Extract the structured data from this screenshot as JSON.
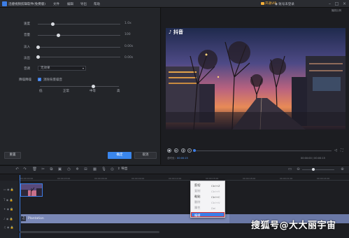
{
  "titlebar": {
    "app_title": "迅捷视频剪辑软件(免费版)",
    "menus": [
      "文件",
      "编辑",
      "导出",
      "帮助"
    ],
    "vip_label": "开通VIP",
    "user_label": "账号未登录",
    "window_buttons": [
      "minimize-icon",
      "maximize-icon",
      "close-icon"
    ]
  },
  "editor": {
    "rows": [
      {
        "label": "速度",
        "value": "1.0x",
        "level": 0.25
      },
      {
        "label": "音量",
        "value": "100",
        "level": 0.27
      },
      {
        "label": "淡入",
        "value": "0.00s",
        "level": 0.0
      },
      {
        "label": "淡出",
        "value": "0.00s",
        "level": 0.0
      }
    ],
    "rate_label": "音调",
    "rate_value": "无效果",
    "denoise_label": "降噪降噪",
    "denoise_option": "消除背景噪音",
    "denoise_checked": true,
    "levels": [
      "低",
      "正常",
      "中等",
      "高"
    ],
    "level_selected": "中等",
    "reset_label": "重置",
    "ok_label": "确定",
    "cancel_label": "取消"
  },
  "preview": {
    "mode_label": "播放比例",
    "watermark": "♪ 抖音",
    "time_current": "00:00:00",
    "time_total": "00:00:15",
    "time_label": "总时长：",
    "progress": 0.0
  },
  "timeline_toolbar": {
    "tools": [
      "undo-icon",
      "redo-icon",
      "delete-icon",
      "cut-icon",
      "crop-icon",
      "copy-icon",
      "speed-icon",
      "freeze-icon",
      "mic-icon",
      "split-icon",
      "mosaic-icon"
    ],
    "export_label": "导出",
    "zoom_level": 0.3
  },
  "timeline": {
    "ruler_ticks": [
      "00:00:00:00",
      "00:00:03:00",
      "00:00:06:00",
      "00:00:09:00",
      "00:00:12:00",
      "00:00:15:00",
      "00:00:18:00",
      "00:00:21:00",
      "00:00:24:00"
    ],
    "audio_title": "Plantation"
  },
  "context_menu": {
    "items": [
      {
        "label": "剪切",
        "shortcut": "Ctrl+Z",
        "disabled": false
      },
      {
        "label": "复制",
        "shortcut": "Ctrl+Y",
        "disabled": true
      },
      {
        "label": "粘贴",
        "shortcut": "Ctrl+C",
        "disabled": false
      },
      {
        "label": "删除",
        "shortcut": "Ctrl+V",
        "disabled": true
      },
      {
        "label": "属性",
        "shortcut": "Del",
        "disabled": true
      }
    ],
    "highlighted_label": "编辑"
  },
  "overlay": {
    "sohu_watermark": "搜狐号@大大丽宇宙"
  }
}
